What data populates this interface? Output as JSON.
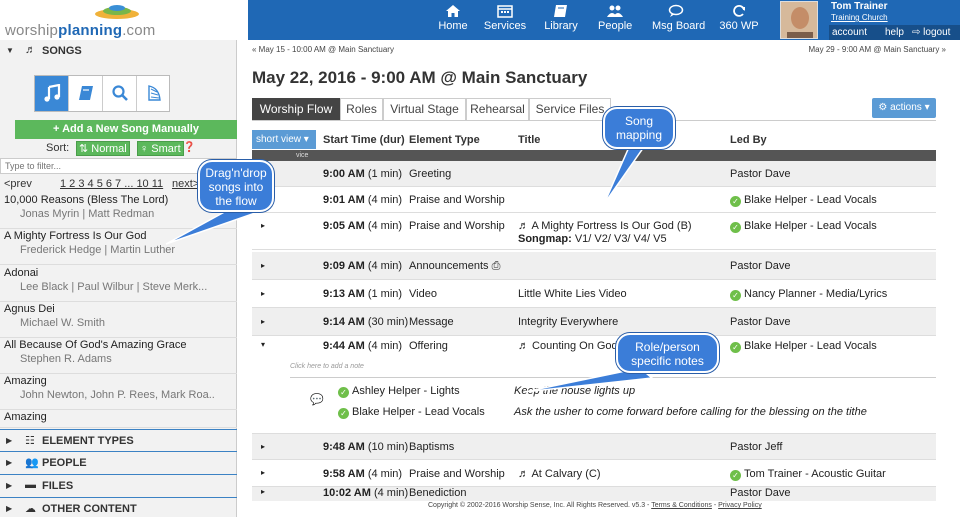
{
  "logo": {
    "word_prefix": "worship",
    "word_bold": "planning",
    "word_suffix": ".com"
  },
  "nav": [
    {
      "label": "Home",
      "icon": "home-icon"
    },
    {
      "label": "Services",
      "icon": "calendar-icon"
    },
    {
      "label": "Library",
      "icon": "book-icon"
    },
    {
      "label": "People",
      "icon": "people-icon"
    },
    {
      "label": "Msg Board",
      "icon": "chat-icon"
    },
    {
      "label": "360 WP",
      "icon": "refresh-icon"
    }
  ],
  "user": {
    "name": "Tom Trainer",
    "church": "Training Church",
    "account": "account",
    "help": "help",
    "logout": "⇨ logout"
  },
  "sidebar": {
    "songs_header": "SONGS",
    "add_song": "+ Add a New Song Manually",
    "sort_label": "Sort:",
    "sort_normal": "⇅ Normal",
    "sort_smart": "♀ Smart",
    "sort_help": "❓",
    "filter_placeholder": "Type to filter...",
    "pager_prev": "<prev",
    "pager_pages": "1 2 3 4 5 6 7 ... 10 11",
    "pager_next": "next>",
    "songs": [
      {
        "title": "10,000 Reasons (Bless The Lord)",
        "authors": "Jonas Myrin | Matt Redman"
      },
      {
        "title": "A Mighty Fortress Is Our God",
        "authors": "Frederick Hedge | Martin Luther"
      },
      {
        "title": "Adonai",
        "authors": "Lee Black | Paul Wilbur | Steve Merk..."
      },
      {
        "title": "Agnus Dei",
        "authors": "Michael W. Smith"
      },
      {
        "title": "All Because Of God's Amazing Grace",
        "authors": "Stephen R. Adams"
      },
      {
        "title": "Amazing",
        "authors": "John Newton, John P. Rees, Mark Roa.."
      },
      {
        "title": "Amazing",
        "authors": ""
      }
    ],
    "sections": [
      "ELEMENT TYPES",
      "PEOPLE",
      "FILES",
      "OTHER CONTENT"
    ]
  },
  "main": {
    "prev_link": "« May 15 - 10:00 AM @ Main Sanctuary",
    "next_link": "May 29 - 9:00 AM @ Main Sanctuary »",
    "title": "May 22, 2016 - 9:00 AM @ Main Sanctuary",
    "tabs": [
      "Worship Flow",
      "Roles",
      "Virtual Stage",
      "Rehearsal",
      "Service Files"
    ],
    "actions": "⚙ actions ▾",
    "view_button": "short view ▾",
    "columns": [
      "Start Time (dur)",
      "Element Type",
      "Title",
      "Led By"
    ],
    "service_bar": "vice",
    "rows": [
      {
        "time": "9:00 AM",
        "dur": "(1 min)",
        "type": "Greeting",
        "title": "",
        "songmap": "",
        "led": "Pastor Dave",
        "led_check": false
      },
      {
        "time": "9:01 AM",
        "dur": "(4 min)",
        "type": "Praise and Worship",
        "title": "",
        "songmap": "",
        "led": "Blake Helper - Lead Vocals",
        "led_check": true
      },
      {
        "time": "9:05 AM",
        "dur": "(4 min)",
        "type": "Praise and Worship",
        "title": "♬ A Mighty Fortress Is Our God (B)",
        "songmap_label": "Songmap:",
        "songmap": "V1/ V2/ V3/ V4/ V5",
        "led": "Blake Helper - Lead Vocals",
        "led_check": true
      },
      {
        "time": "9:09 AM",
        "dur": "(4 min)",
        "type": "Announcements",
        "title": "",
        "songmap": "",
        "led": "Pastor Dave",
        "led_check": false
      },
      {
        "time": "9:13 AM",
        "dur": "(1 min)",
        "type": "Video",
        "title": "Little White Lies Video",
        "songmap": "",
        "led": "Nancy Planner - Media/Lyrics",
        "led_check": true
      },
      {
        "time": "9:14 AM",
        "dur": "(30 min)",
        "type": "Message",
        "title": "Integrity Everywhere",
        "songmap": "",
        "led": "Pastor Dave",
        "led_check": false
      },
      {
        "time": "9:44 AM",
        "dur": "(4 min)",
        "type": "Offering",
        "title": "♬ Counting On God",
        "songmap": "",
        "led": "Blake Helper - Lead Vocals",
        "led_check": true
      },
      {
        "time": "9:48 AM",
        "dur": "(10 min)",
        "type": "Baptisms",
        "title": "",
        "songmap": "",
        "led": "Pastor Jeff",
        "led_check": false
      },
      {
        "time": "9:58 AM",
        "dur": "(4 min)",
        "type": "Praise and Worship",
        "title": "♬ At Calvary (C)",
        "songmap": "",
        "led": "Tom Trainer - Acoustic Guitar",
        "led_check": true
      },
      {
        "time": "10:02 AM",
        "dur": "(4 min)",
        "type": "Benediction",
        "title": "",
        "songmap": "",
        "led": "Pastor Dave",
        "led_check": false
      }
    ],
    "add_note": "Click here to add a note",
    "notes": [
      {
        "person": "Ashley Helper - Lights",
        "note": "Keep the house lights up"
      },
      {
        "person": "Blake Helper - Lead Vocals",
        "note": "Ask the usher to come forward before calling for the blessing on the tithe"
      }
    ],
    "copyright": "Copyright © 2002-2016 Worship Sense, Inc. All Rights Reserved. v5.3 - ",
    "terms": "Terms & Conditions",
    "privacy": "Privacy Policy"
  },
  "callouts": {
    "dragdrop": [
      "Drag'n'drop",
      "songs into",
      "the flow"
    ],
    "songmap": [
      "Song",
      "mapping"
    ],
    "notes": [
      "Role/person",
      "specific notes"
    ]
  },
  "colors": {
    "topbar": "#1f68b5",
    "green": "#5cb85c",
    "blue_btn": "#5b9bd5",
    "callout": "#3b7dd8"
  }
}
